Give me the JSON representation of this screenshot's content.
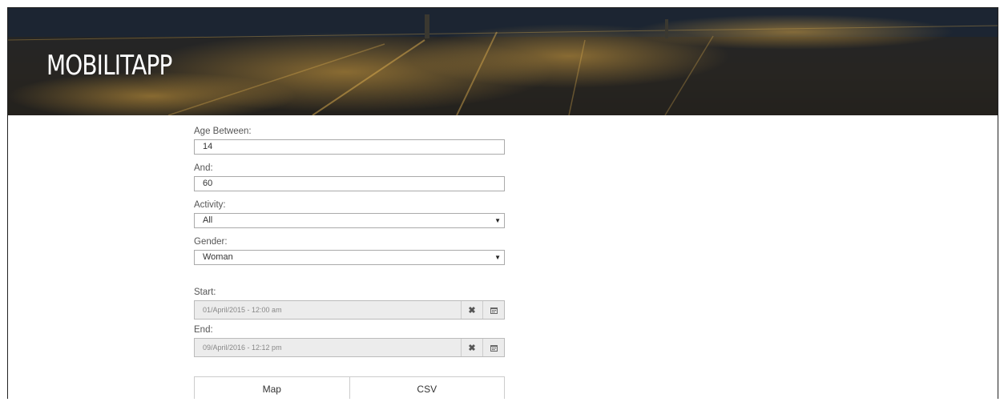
{
  "header": {
    "title": "MOBILITAPP"
  },
  "form": {
    "age_min": {
      "label": "Age Between:",
      "value": "14"
    },
    "age_max": {
      "label": "And:",
      "value": "60"
    },
    "activity": {
      "label": "Activity:",
      "value": "All"
    },
    "gender": {
      "label": "Gender:",
      "value": "Woman"
    },
    "start": {
      "label": "Start:",
      "value": "01/April/2015 - 12:00 am"
    },
    "end": {
      "label": "End:",
      "value": "09/April/2016 - 12:12 pm"
    }
  },
  "actions": {
    "map_label": "Map",
    "csv_label": "CSV"
  },
  "icons": {
    "clear": "close-icon",
    "calendar": "calendar-icon",
    "dropdown": "caret-down-icon"
  }
}
